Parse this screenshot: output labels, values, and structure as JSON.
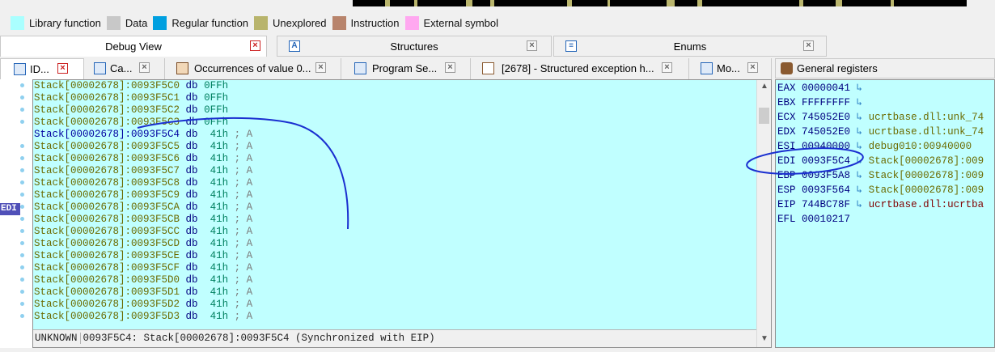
{
  "legend": [
    {
      "label": "Library function",
      "color": "#aaffff"
    },
    {
      "label": "Data",
      "color": "#c8c8c8"
    },
    {
      "label": "Regular function",
      "color": "#00a0e0"
    },
    {
      "label": "Unexplored",
      "color": "#b8b46c"
    },
    {
      "label": "Instruction",
      "color": "#b8846c"
    },
    {
      "label": "External symbol",
      "color": "#ffa8f0"
    }
  ],
  "dock_tabs": {
    "debug_view": "Debug View",
    "structures": "Structures",
    "enums": "Enums"
  },
  "sub_tabs": [
    {
      "label": "ID..."
    },
    {
      "label": "Ca..."
    },
    {
      "label": "Occurrences of value 0..."
    },
    {
      "label": "Program Se..."
    },
    {
      "label": "[2678] - Structured exception h..."
    },
    {
      "label": "Mo..."
    }
  ],
  "disasm": {
    "current_index": 4,
    "lines": [
      {
        "addr": "Stack[00002678]:0093F5C0",
        "mn": "db",
        "val": "0FFh",
        "cmt": ""
      },
      {
        "addr": "Stack[00002678]:0093F5C1",
        "mn": "db",
        "val": "0FFh",
        "cmt": ""
      },
      {
        "addr": "Stack[00002678]:0093F5C2",
        "mn": "db",
        "val": "0FFh",
        "cmt": ""
      },
      {
        "addr": "Stack[00002678]:0093F5C3",
        "mn": "db",
        "val": "0FFh",
        "cmt": ""
      },
      {
        "addr": "Stack[00002678]:0093F5C4",
        "mn": "db",
        "val": " 41h",
        "cmt": " ; A"
      },
      {
        "addr": "Stack[00002678]:0093F5C5",
        "mn": "db",
        "val": " 41h",
        "cmt": " ; A"
      },
      {
        "addr": "Stack[00002678]:0093F5C6",
        "mn": "db",
        "val": " 41h",
        "cmt": " ; A"
      },
      {
        "addr": "Stack[00002678]:0093F5C7",
        "mn": "db",
        "val": " 41h",
        "cmt": " ; A"
      },
      {
        "addr": "Stack[00002678]:0093F5C8",
        "mn": "db",
        "val": " 41h",
        "cmt": " ; A"
      },
      {
        "addr": "Stack[00002678]:0093F5C9",
        "mn": "db",
        "val": " 41h",
        "cmt": " ; A"
      },
      {
        "addr": "Stack[00002678]:0093F5CA",
        "mn": "db",
        "val": " 41h",
        "cmt": " ; A"
      },
      {
        "addr": "Stack[00002678]:0093F5CB",
        "mn": "db",
        "val": " 41h",
        "cmt": " ; A"
      },
      {
        "addr": "Stack[00002678]:0093F5CC",
        "mn": "db",
        "val": " 41h",
        "cmt": " ; A"
      },
      {
        "addr": "Stack[00002678]:0093F5CD",
        "mn": "db",
        "val": " 41h",
        "cmt": " ; A"
      },
      {
        "addr": "Stack[00002678]:0093F5CE",
        "mn": "db",
        "val": " 41h",
        "cmt": " ; A"
      },
      {
        "addr": "Stack[00002678]:0093F5CF",
        "mn": "db",
        "val": " 41h",
        "cmt": " ; A"
      },
      {
        "addr": "Stack[00002678]:0093F5D0",
        "mn": "db",
        "val": " 41h",
        "cmt": " ; A"
      },
      {
        "addr": "Stack[00002678]:0093F5D1",
        "mn": "db",
        "val": " 41h",
        "cmt": " ; A"
      },
      {
        "addr": "Stack[00002678]:0093F5D2",
        "mn": "db",
        "val": " 41h",
        "cmt": " ; A"
      },
      {
        "addr": "Stack[00002678]:0093F5D3",
        "mn": "db",
        "val": " 41h",
        "cmt": " ; A"
      }
    ],
    "status_mode": "UNKNOWN",
    "status_text": "0093F5C4: Stack[00002678]:0093F5C4 (Synchronized with EIP)"
  },
  "gutter": {
    "edi_marker": "EDI"
  },
  "registers": {
    "title": "General registers",
    "rows": [
      {
        "name": "EAX",
        "value": "00000041",
        "target": "",
        "red": false
      },
      {
        "name": "EBX",
        "value": "FFFFFFFF",
        "target": "",
        "red": false
      },
      {
        "name": "ECX",
        "value": "745052E0",
        "target": "ucrtbase.dll:unk_74",
        "red": false
      },
      {
        "name": "EDX",
        "value": "745052E0",
        "target": "ucrtbase.dll:unk_74",
        "red": false
      },
      {
        "name": "ESI",
        "value": "00940000",
        "target": "debug010:00940000",
        "red": false
      },
      {
        "name": "EDI",
        "value": "0093F5C4",
        "target": "Stack[00002678]:009",
        "red": false
      },
      {
        "name": "EBP",
        "value": "0093F5A8",
        "target": "Stack[00002678]:009",
        "red": false
      },
      {
        "name": "ESP",
        "value": "0093F564",
        "target": "Stack[00002678]:009",
        "red": false
      },
      {
        "name": "EIP",
        "value": "744BC78F",
        "target": "ucrtbase.dll:ucrtba",
        "red": true
      },
      {
        "name": "EFL",
        "value": "00010217",
        "target": "",
        "red": false
      }
    ]
  },
  "colors": {
    "disasm_bg": "#c0ffff",
    "annotation_ink": "#1a2fd0"
  }
}
